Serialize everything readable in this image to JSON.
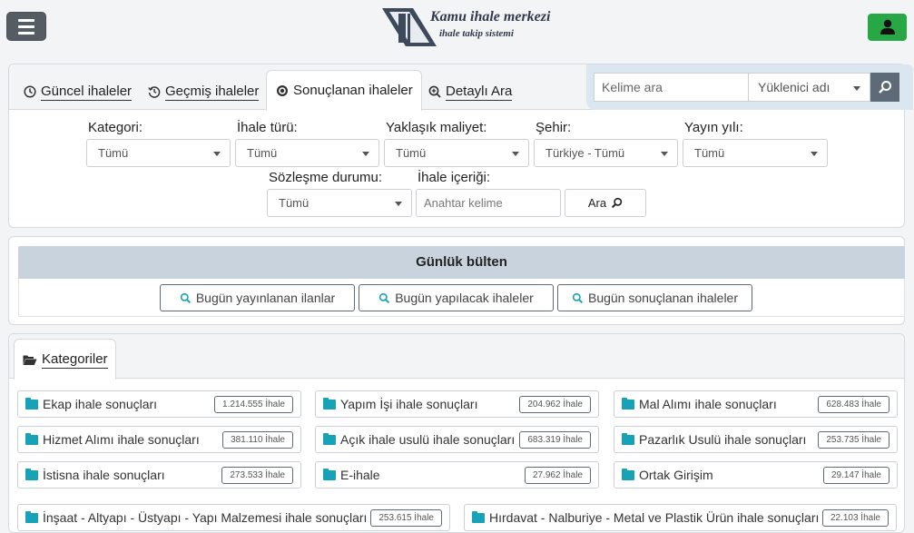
{
  "header": {
    "logo_title": "Kamu ihale merkezi",
    "logo_subtitle": "ihale takip sistemi",
    "menu_icon": "hamburger-icon",
    "user_icon": "user-icon",
    "user_button_color": "#28a745"
  },
  "tabs": [
    {
      "label": "Güncel ihaleler",
      "icon": "clock-icon"
    },
    {
      "label": "Geçmiş ihaleler",
      "icon": "history-icon"
    },
    {
      "label": "Sonuçlanan ihaleler",
      "icon": "dot-circle-icon",
      "active": true
    },
    {
      "label": "Detaylı Ara",
      "icon": "zoom-in-icon"
    }
  ],
  "search": {
    "keyword_placeholder": "Kelime ara",
    "contractor_value": "Yüklenici adı"
  },
  "filters": {
    "kategori": {
      "label": "Kategori:",
      "value": "Tümü"
    },
    "ihale_turu": {
      "label": "İhale türü:",
      "value": "Tümü"
    },
    "maliyet": {
      "label": "Yaklaşık maliyet:",
      "value": "Tümü"
    },
    "sehir": {
      "label": "Şehir:",
      "value": "Türkiye - Tümü"
    },
    "yayin_yili": {
      "label": "Yayın yılı:",
      "value": "Tümü"
    },
    "sozlesme": {
      "label": "Sözleşme durumu:",
      "value": "Tümü"
    },
    "icerik": {
      "label": "İhale içeriği:",
      "placeholder": "Anahtar kelime"
    },
    "ara_label": "Ara"
  },
  "bulten": {
    "title": "Günlük bülten",
    "buttons": [
      "Bugün yayınlanan ilanlar",
      "Bugün yapılacak ihaleler",
      "Bugün sonuçlanan ihaleler"
    ]
  },
  "kategoriler": {
    "tab_label": "Kategoriler",
    "items": [
      {
        "label": "Ekap ihale sonuçları",
        "count": "1.214.555 İhale"
      },
      {
        "label": "Yapım İşi ihale sonuçları",
        "count": "204.962 İhale"
      },
      {
        "label": "Mal Alımı ihale sonuçları",
        "count": "628.483 İhale"
      },
      {
        "label": "Hizmet Alımı ihale sonuçları",
        "count": "381.110 İhale"
      },
      {
        "label": "Açık ihale usulü ihale sonuçları",
        "count": "683.319 İhale"
      },
      {
        "label": "Pazarlık Usulü ihale sonuçları",
        "count": "253.735 İhale"
      },
      {
        "label": "İstisna ihale sonuçları",
        "count": "273.533 İhale"
      },
      {
        "label": "E-ihale",
        "count": "27.962 İhale"
      },
      {
        "label": "Ortak Girişim",
        "count": "29.147 İhale"
      },
      {
        "label": "İnşaat - Altyapı - Üstyapı - Yapı Malzemesi ihale sonuçları",
        "count": "253.615 İhale"
      },
      {
        "label": "Hırdavat - Nalburiye - Metal ve Plastik Ürün ihale sonuçları",
        "count": "22.103 İhale"
      }
    ]
  }
}
